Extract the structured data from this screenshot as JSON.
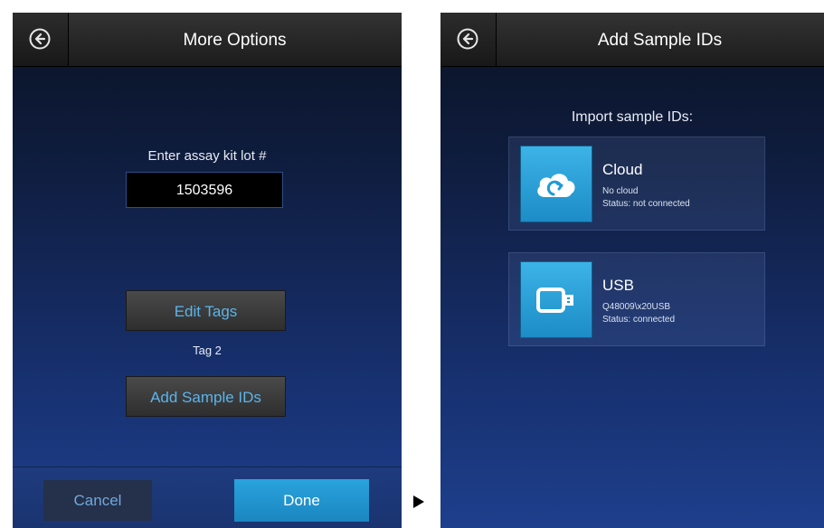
{
  "left_screen": {
    "title": "More Options",
    "lot_label": "Enter assay kit lot #",
    "lot_value": "1503596",
    "edit_tags_label": "Edit Tags",
    "tag_text": "Tag 2",
    "add_sample_ids_label": "Add Sample IDs",
    "cancel_label": "Cancel",
    "done_label": "Done"
  },
  "right_screen": {
    "title": "Add Sample IDs",
    "import_label": "Import sample IDs:",
    "options": [
      {
        "title": "Cloud",
        "line1": "No cloud",
        "line2": "Status: not connected",
        "icon": "cloud-upload-icon"
      },
      {
        "title": "USB",
        "line1": "Q48009\\x20USB",
        "line2": "Status: connected",
        "icon": "usb-drive-icon"
      }
    ]
  },
  "colors": {
    "accent": "#1e9bd7",
    "button_text": "#5cb4ea",
    "screen_background": "#13285a"
  }
}
